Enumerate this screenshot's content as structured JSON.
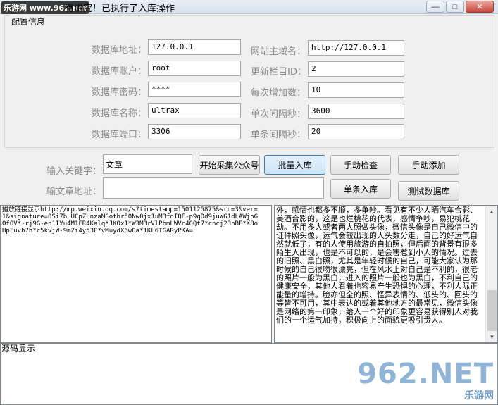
{
  "window": {
    "watermark_top": "乐游网 www.962.net",
    "title": "有讲究！已执行了入库操作"
  },
  "config": {
    "legend": "配置信息",
    "db_address_label": "数据库地址：",
    "db_address_value": "127.0.0.1",
    "db_account_label": "数据库账户：",
    "db_account_value": "root",
    "db_password_label": "数据库密码：",
    "db_password_value": "****",
    "db_name_label": "数据库名称：",
    "db_name_value": "ultrax",
    "db_port_label": "数据库端口：",
    "db_port_value": "3306",
    "site_domain_label": "网站主域名：",
    "site_domain_value": "http://127.0.0.1",
    "column_id_label": "更新栏目ID：",
    "column_id_value": "2",
    "increment_label": "每次增加数：",
    "increment_value": "10",
    "interval_label": "单次间隔秒：",
    "interval_value": "3600",
    "item_interval_label": "单条间隔秒：",
    "item_interval_value": "20"
  },
  "controls": {
    "keyword_label": "输入关键字：",
    "keyword_value": "文章",
    "article_url_label": "输文章地址：",
    "article_url_value": "",
    "btn_start_collect": "开始采集公众号",
    "btn_batch_import": "批量入库",
    "btn_manual_check": "手动检查",
    "btn_manual_add": "手动添加",
    "btn_single_import": "单条入库",
    "btn_test_db": "测试数据库"
  },
  "log": {
    "text": "播放链接显示http://mp.weixin.qq.com/s?timestamp=1501125875&src=3&ver=1&signature=0Si7bLUCpZLnzaMGotbr50Nw0jx1uM3fdIQE-p9qDd9juWG1dLAWjpGOfOV*-rj9G-en1IYu4M1FR4Kalq*JKOx1*W3M3rVlPbmLWVc40Qt7*cncj23nBF*K8oHpFuvh7h*c5kvjW-9mZi4y53P*vMuydX6w0a*1KL6TGARyPKA="
  },
  "article": {
    "text": "外，感情也都多不顺，多争吵。看见有不少人晒汽车合影、美酒合影的，这是也烂桃花的代表，感情争吵，易犯桃花劫。不用多人或者两人照做头像，微信头像是自己微信中的证件照头像，运气会较出现的人头数分走，自己的好运气自然就低了，有的人使用旅游的自拍照，但后面的背景有很多陌生人出现，也是不可以的，是会害惹到小人的情况。过去的旧照、黑白照，尤其是年轻时候的自己，可能大家认为那时候的自己很吻很漂亮，但在风水上对自己是不利的，很老的照片一般为黑白，进入的照片一般也为黑白，不利自己的健康安全，其他人看着也容易产生恐惧的心理，不利人际正能量的增持。脸亦但全的照、怪异表情的、低头的、回头的等皆不可用，其中表达的或着其他地方的最常见，微信头像是网络的第一印象，给人一个好的印象更容易获得别人对我们的一个运气加持，积极向上的面貌更吸引贵人。"
  },
  "source": {
    "label": "源码显示"
  },
  "watermark_bottom": {
    "big": "962.NET",
    "small": "乐游网"
  }
}
